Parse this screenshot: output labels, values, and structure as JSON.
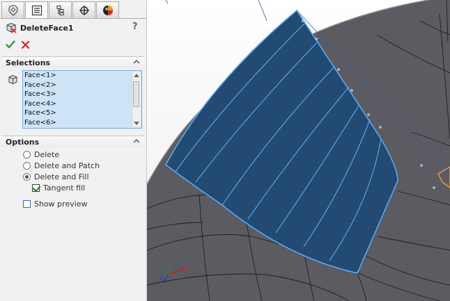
{
  "tabs": [
    {
      "name": "feature-manager-tab",
      "icon": "feature-tree-icon"
    },
    {
      "name": "property-manager-tab",
      "icon": "property-list-icon"
    },
    {
      "name": "configuration-manager-tab",
      "icon": "configuration-icon"
    },
    {
      "name": "dimxpert-tab",
      "icon": "crosshair-icon"
    },
    {
      "name": "display-manager-tab",
      "icon": "appearance-ball-icon"
    }
  ],
  "header": {
    "title": "DeleteFace1",
    "help": "?"
  },
  "selections": {
    "heading": "Selections",
    "items": [
      "Face<1>",
      "Face<2>",
      "Face<3>",
      "Face<4>",
      "Face<5>",
      "Face<6>"
    ]
  },
  "options": {
    "heading": "Options",
    "delete": "Delete",
    "delete_and_patch": "Delete and Patch",
    "delete_and_fill": "Delete and Fill",
    "tangent_fill": "Tangent fill",
    "show_preview": "Show preview",
    "selected": "delete_and_fill",
    "tangent_fill_checked": true,
    "show_preview_checked": false
  },
  "triad": {
    "x": "X",
    "y": "Y",
    "z": "Z"
  },
  "colors": {
    "face": "#234a73",
    "edge": "#5aaaf0",
    "body": "#5b5b61",
    "accept": "#2f9a2f",
    "cancel": "#d22222"
  }
}
